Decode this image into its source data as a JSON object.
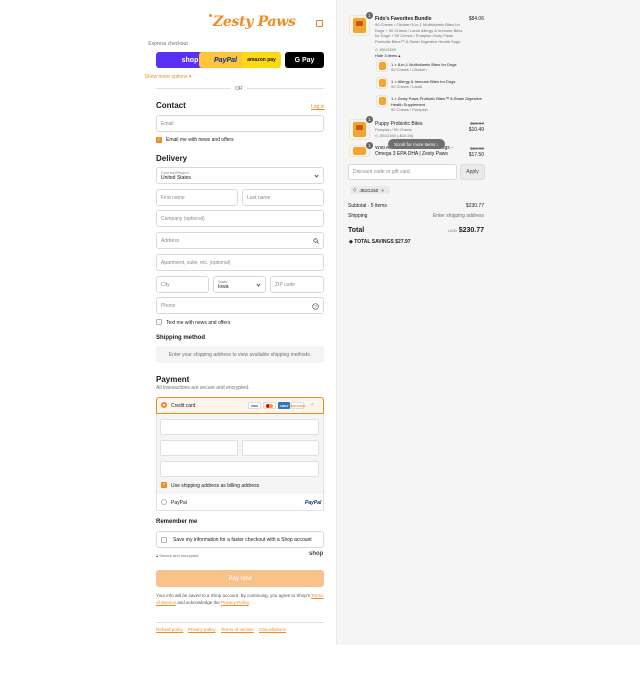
{
  "brand": {
    "name": "Zesty Paws"
  },
  "express": {
    "title": "Express checkout",
    "shop": "shop",
    "paypal": "PayPal",
    "amazon": "amazon pay",
    "gpay": "G Pay",
    "more": "Show more options ▾",
    "or": "OR"
  },
  "contact": {
    "title": "Contact",
    "login": "Log in",
    "email_placeholder": "Email",
    "news_label": "Email me with news and offers"
  },
  "delivery": {
    "title": "Delivery",
    "country_label": "Country/Region",
    "country": "United States",
    "first_name": "First name",
    "last_name": "Last name",
    "company": "Company (optional)",
    "address": "Address",
    "apartment": "Apartment, suite, etc. (optional)",
    "city": "City",
    "state_label": "State",
    "state": "Iowa",
    "zip": "ZIP code",
    "phone": "Phone",
    "text_label": "Text me with news and offers"
  },
  "shipping_method": {
    "title": "Shipping method",
    "note": "Enter your shipping address to view available shipping methods."
  },
  "payment": {
    "title": "Payment",
    "note": "All transactions are secure and encrypted.",
    "credit_card": "Credit card",
    "billing": "Use shipping address as billing address",
    "paypal": "PayPal",
    "paypal_logo": "PayPal",
    "visa": "VISA",
    "amex": "AMEX",
    "discover": "DISCOVER"
  },
  "remember": {
    "title": "Remember me",
    "save": "Save my information for a faster checkout with a Shop account",
    "secure": "Secure and encrypted",
    "shop": "shop"
  },
  "pay_now": "Pay now",
  "legal": {
    "prefix": "Your info will be saved to a Shop account. By continuing, you agree to Shop's",
    "terms": "Terms of Service",
    "mid": "and acknowledge the",
    "privacy": "Privacy Policy",
    "end": "."
  },
  "footer": {
    "refund": "Refund policy",
    "privacy": "Privacy policy",
    "terms": "Terms of service",
    "cancellations": "Cancellations"
  },
  "cart": {
    "items": [
      {
        "qty": "1",
        "name": "Fido's Favorites Bundle",
        "desc": "90 Chews / Chicken 6-in-1 Multivitamin Bites for Dogs + 90 Chews / Lamb Allergy & Immune Bites for Dogs + 90 Chews / Pumpkin Zesty Paws Probiotic Bites™ 8-Strain Digestive Health Supp",
        "tag": "JB1G150",
        "price": "$84.06",
        "hide": "Hide 3 items ▴",
        "sub": [
          {
            "name": "1 × 8-in-1 Multivitamin Bites for Dogs",
            "desc": "90 Chews / Chicken"
          },
          {
            "name": "1 × Allergy & Immune Bites for Dogs",
            "desc": "90 Chews / Lamb"
          },
          {
            "name": "1 × Zesty Paws Probiotic Bites™ 8-Strain Digestive Health Supplement",
            "desc": "90 Chews / Pumpkin"
          }
        ]
      },
      {
        "qty": "1",
        "name": "Puppy Probiotic Bites",
        "desc": "Pumpkin / 90 Chews",
        "tag": "JB1G150 (-$10.49)",
        "old_price": "$20.97",
        "price": "$10.49"
      },
      {
        "qty": "1",
        "name": "Wild Alaskan Salmon Oil for Dogs - Omega 3 EPA DHA | Zesty Paws",
        "old_price": "$34.99",
        "price": "$17.50"
      }
    ],
    "tooltip": "Scroll for more items",
    "discount_placeholder": "Discount code or gift card",
    "apply": "Apply",
    "code": "JB1G150",
    "subtotal_label": "Subtotal · 5 items",
    "subtotal": "$230.77",
    "shipping_label": "Shipping",
    "shipping": "Enter shipping address",
    "total_label": "Total",
    "currency": "USD",
    "total": "$230.77",
    "savings": "TOTAL SAVINGS $27.97"
  }
}
